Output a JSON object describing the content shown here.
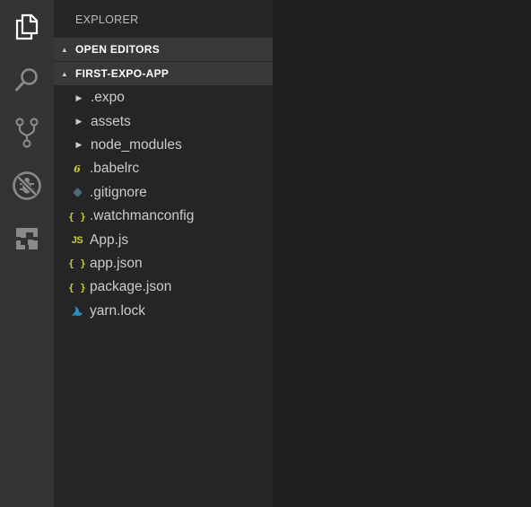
{
  "activity_bar": {
    "items": [
      {
        "name": "explorer",
        "icon": "files-icon"
      },
      {
        "name": "search",
        "icon": "search-icon"
      },
      {
        "name": "source-control",
        "icon": "source-control-icon"
      },
      {
        "name": "debug",
        "icon": "debug-icon"
      },
      {
        "name": "extensions",
        "icon": "extensions-icon"
      }
    ]
  },
  "sidebar": {
    "title": "EXPLORER",
    "open_editors_label": "OPEN EDITORS",
    "project_label": "FIRST-EXPO-APP",
    "tree": [
      {
        "label": ".expo",
        "type": "folder"
      },
      {
        "label": "assets",
        "type": "folder"
      },
      {
        "label": "node_modules",
        "type": "folder"
      },
      {
        "label": ".babelrc",
        "type": "file",
        "icon": "babel-icon",
        "glyph": "6"
      },
      {
        "label": ".gitignore",
        "type": "file",
        "icon": "git-icon",
        "glyph": "◆"
      },
      {
        "label": ".watchmanconfig",
        "type": "file",
        "icon": "json-icon",
        "glyph": "{ }"
      },
      {
        "label": "App.js",
        "type": "file",
        "icon": "js-icon",
        "glyph": "JS"
      },
      {
        "label": "app.json",
        "type": "file",
        "icon": "json-icon",
        "glyph": "{ }"
      },
      {
        "label": "package.json",
        "type": "file",
        "icon": "json-icon",
        "glyph": "{ }"
      },
      {
        "label": "yarn.lock",
        "type": "file",
        "icon": "yarn-icon",
        "glyph": ""
      }
    ]
  },
  "colors": {
    "activity_bar": "#333333",
    "sidebar": "#252526",
    "editor": "#1e1e1e",
    "section_header": "#383838",
    "icon_yellow": "#cbcb41",
    "yarn_blue": "#2c8ebb"
  }
}
